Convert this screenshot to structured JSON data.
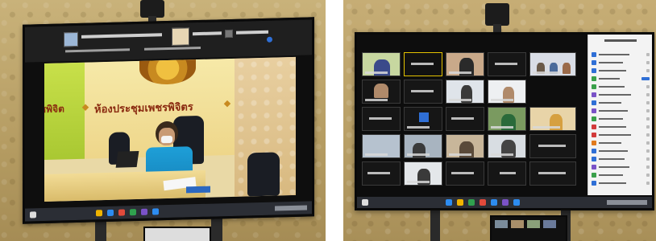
{
  "left_photo": {
    "room_sign": "ห้องประชุมเพชรพิจิตร",
    "wall_text_partial": "ชพิจิต",
    "colors": {
      "backdrop_green": "#b8d43a",
      "shirt_blue": "#1e9fd8",
      "sign_red": "#8a2a10"
    }
  },
  "right_photo": {
    "colors": {
      "participants_panel": "#f3f3f3",
      "avatar_blue": "#2f6fd6"
    }
  }
}
